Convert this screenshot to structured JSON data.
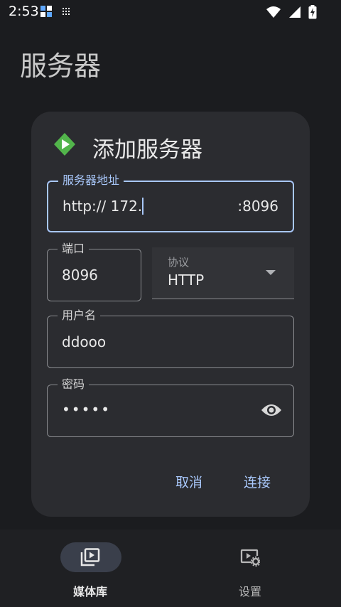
{
  "status_bar": {
    "time": "2:53"
  },
  "page": {
    "title": "服务器"
  },
  "dialog": {
    "title": "添加服务器",
    "server_address": {
      "label": "服务器地址",
      "value": "http:// 172.",
      "port_suffix": ":8096"
    },
    "port": {
      "label": "端口",
      "value": "8096"
    },
    "protocol": {
      "label": "协议",
      "value": "HTTP"
    },
    "username": {
      "label": "用户名",
      "value": "ddooo"
    },
    "password": {
      "label": "密码",
      "value": "•••••"
    },
    "cancel_label": "取消",
    "connect_label": "连接"
  },
  "bottom_nav": {
    "items": [
      {
        "label": "媒体库",
        "icon": "video-library-icon",
        "selected": true
      },
      {
        "label": "设置",
        "icon": "video-settings-icon",
        "selected": false
      }
    ]
  },
  "colors": {
    "accent": "#a8c7fa",
    "logo": "#52b54b",
    "background": "#1b1c1f",
    "dialog": "#2b2c30"
  }
}
